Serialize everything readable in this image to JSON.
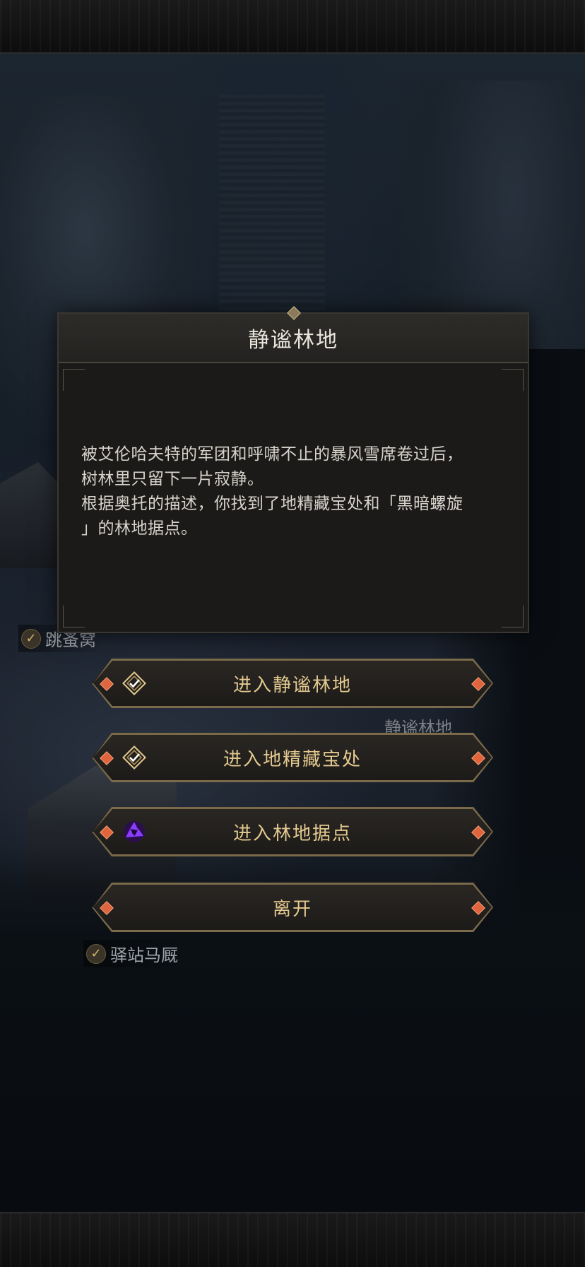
{
  "dialog": {
    "title": "静谧林地",
    "text_lines": [
      "被艾伦哈夫特的军团和呼啸不止的暴风雪席卷过后，",
      "树林里只留下一片寂静。",
      "根据奥托的描述，你找到了地精藏宝处和「黑暗螺旋",
      "」的林地据点。"
    ]
  },
  "options": [
    {
      "label": "进入静谧林地",
      "icon": "check-diamond-icon"
    },
    {
      "label": "进入地精藏宝处",
      "icon": "check-diamond-icon"
    },
    {
      "label": "进入林地据点",
      "icon": "dark-spiral-icon"
    },
    {
      "label": "离开",
      "icon": ""
    }
  ],
  "map_labels": {
    "partial_left": "跳蚤窝",
    "quiet_woods": "静谧林地",
    "stable": "驿站马厩"
  },
  "colors": {
    "accent_gold": "#e3c98f",
    "gem_orange": "#e0643c",
    "spiral_purple": "#8a3cff"
  }
}
